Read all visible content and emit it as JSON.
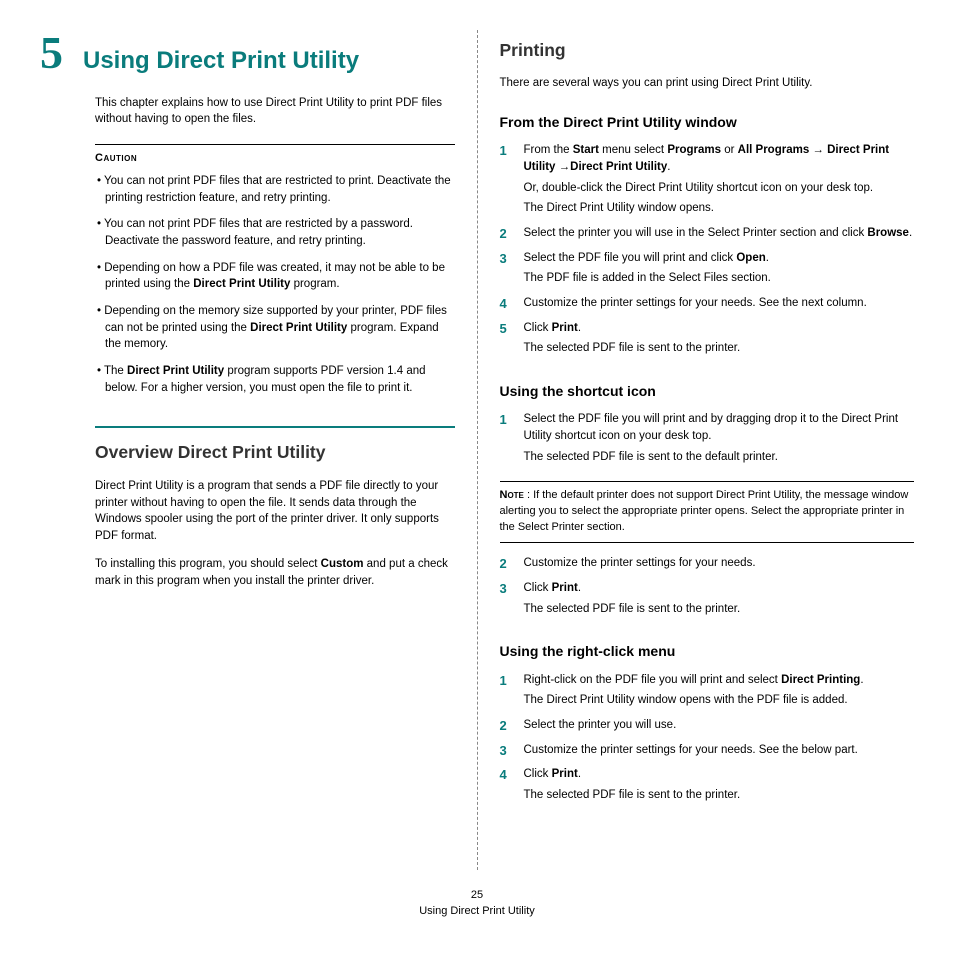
{
  "chapter": {
    "num": "5",
    "title": "Using Direct Print Utility"
  },
  "intro": "This chapter explains how to use Direct Print Utility to print PDF files without having to open the files.",
  "caution": {
    "label": "Caution",
    "items": [
      "You can not print PDF files that are restricted to print. Deactivate the printing restriction feature, and retry printing.",
      "You can not print PDF files that are restricted by a password. Deactivate the password feature, and retry printing.",
      "Depending on how a PDF file was created, it may not be able to be printed using the <b>Direct Print Utility</b> program.",
      "Depending on the memory size supported by your printer, PDF files can not be printed using the <b>Direct Print Utility</b> program. Expand the memory.",
      "The <b>Direct Print Utility</b> program supports PDF version 1.4 and below. For a higher version, you must open the file to print it."
    ]
  },
  "overview": {
    "title": "Overview Direct Print Utility",
    "p1": "Direct Print Utility is a program that sends a PDF file directly to your printer without having to open the file. It sends data through the Windows spooler using the port of the printer driver. It only supports PDF format.",
    "p2": "To installing this program, you should select <b>Custom</b> and put a check mark in this program when you install the printer driver."
  },
  "printing": {
    "title": "Printing",
    "intro": "There are several ways you can print using Direct Print Utility.",
    "fromWindow": {
      "title": "From the Direct Print Utility window",
      "steps": [
        {
          "n": "1",
          "lines": [
            "From the <b>Start</b> menu select <b>Programs</b> or <b>All Programs</b> → <b>Direct Print Utility</b> →<b>Direct Print Utility</b>.",
            "Or, double-click the Direct Print Utility shortcut icon on your desk top.",
            "The Direct Print Utility window opens."
          ]
        },
        {
          "n": "2",
          "lines": [
            "Select the printer you will use in the Select Printer section and click <b>Browse</b>."
          ]
        },
        {
          "n": "3",
          "lines": [
            "Select the PDF file you will print and click <b>Open</b>.",
            "The PDF file is added in the Select Files section."
          ]
        },
        {
          "n": "4",
          "lines": [
            "Customize the printer settings for your needs. See the next column."
          ]
        },
        {
          "n": "5",
          "lines": [
            "Click <b>Print</b>.",
            "The selected PDF file is sent to the printer."
          ]
        }
      ]
    },
    "shortcut": {
      "title": "Using the shortcut icon",
      "stepsA": [
        {
          "n": "1",
          "lines": [
            "Select the PDF file you will print and by dragging drop it to the Direct Print Utility shortcut icon on your desk top.",
            "The selected PDF file is sent to the default printer."
          ]
        }
      ],
      "note": {
        "label": "Note",
        "text": "If the default printer does not support Direct Print Utility, the message window alerting you to select the appropriate printer opens. Select the appropriate printer in the Select Printer section."
      },
      "stepsB": [
        {
          "n": "2",
          "lines": [
            "Customize the printer settings for your needs."
          ]
        },
        {
          "n": "3",
          "lines": [
            "Click <b>Print</b>.",
            "The selected PDF file is sent to the printer."
          ]
        }
      ]
    },
    "rightClick": {
      "title": "Using the right-click menu",
      "steps": [
        {
          "n": "1",
          "lines": [
            "Right-click on the PDF file you will print and select <b>Direct Printing</b>.",
            "The Direct Print Utility window opens with the PDF file is added."
          ]
        },
        {
          "n": "2",
          "lines": [
            "Select the printer you will use."
          ]
        },
        {
          "n": "3",
          "lines": [
            "Customize the printer settings for your needs. See the below part."
          ]
        },
        {
          "n": "4",
          "lines": [
            "Click <b>Print</b>.",
            "The selected PDF file is sent to the printer."
          ]
        }
      ]
    }
  },
  "footer": {
    "page": "25",
    "title": "Using Direct Print Utility"
  }
}
